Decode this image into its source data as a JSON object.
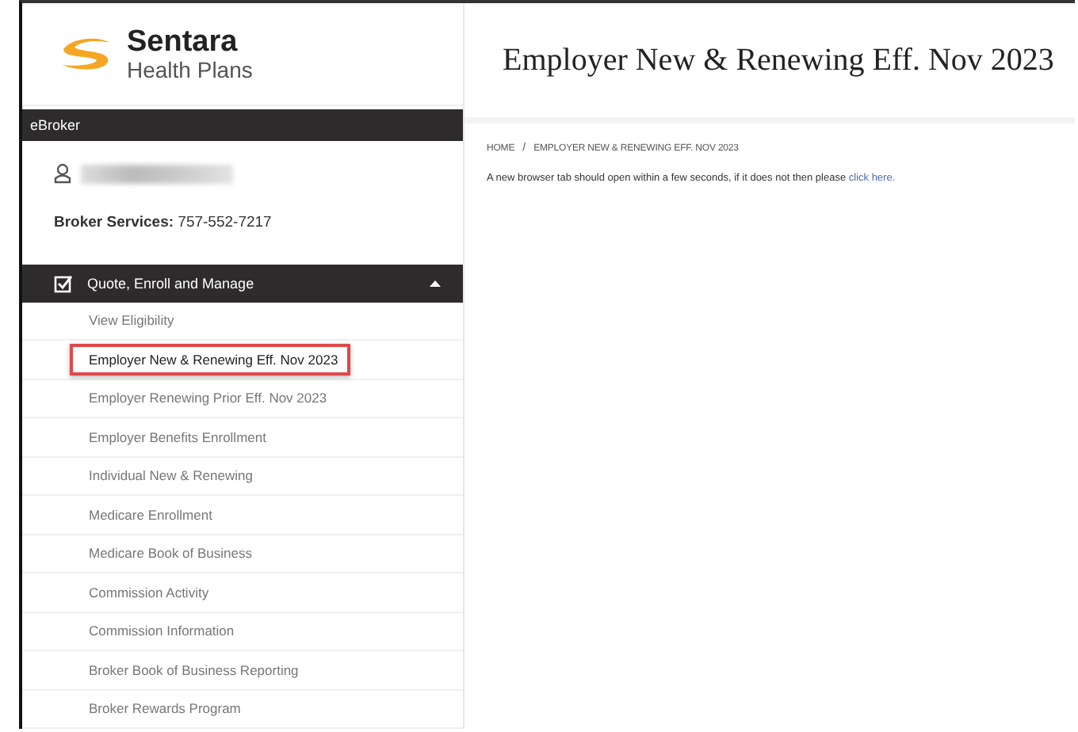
{
  "logo": {
    "name": "Sentara",
    "tagline": "Health Plans"
  },
  "page_title": "Employer New & Renewing Eff. Nov 2023",
  "sidebar": {
    "section_label": "eBroker",
    "user": {
      "redacted": true
    },
    "broker_services": {
      "label": "Broker Services:",
      "phone": "757-552-7217"
    },
    "menu": {
      "title": "Quote, Enroll and Manage",
      "expanded": true,
      "items": [
        {
          "label": "View Eligibility",
          "selected": false
        },
        {
          "label": "Employer New & Renewing Eff. Nov 2023",
          "selected": true
        },
        {
          "label": "Employer Renewing Prior Eff. Nov 2023",
          "selected": false
        },
        {
          "label": "Employer Benefits Enrollment",
          "selected": false
        },
        {
          "label": "Individual New & Renewing",
          "selected": false
        },
        {
          "label": "Medicare Enrollment",
          "selected": false
        },
        {
          "label": "Medicare Book of Business",
          "selected": false
        },
        {
          "label": "Commission Activity",
          "selected": false
        },
        {
          "label": "Commission Information",
          "selected": false
        },
        {
          "label": "Broker Book of Business Reporting",
          "selected": false
        },
        {
          "label": "Broker Rewards Program",
          "selected": false
        }
      ]
    }
  },
  "breadcrumb": [
    "HOME",
    "EMPLOYER NEW & RENEWING EFF. NOV 2023"
  ],
  "breadcrumb_separator": "/",
  "message": {
    "text": "A new browser tab should open within a few seconds, if it does not then please ",
    "link": "click here."
  }
}
